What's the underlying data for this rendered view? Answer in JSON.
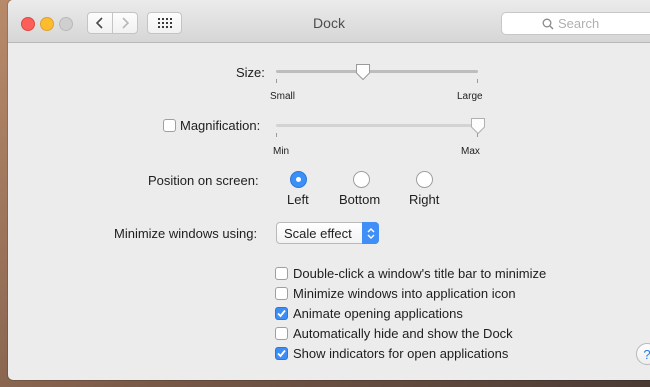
{
  "window": {
    "title": "Dock"
  },
  "search": {
    "placeholder": "Search"
  },
  "size": {
    "label": "Size:",
    "min_label": "Small",
    "max_label": "Large",
    "value_fraction": 0.43
  },
  "magnification": {
    "label": "Magnification:",
    "checked": false,
    "min_label": "Min",
    "max_label": "Max",
    "value_fraction": 1.0
  },
  "position": {
    "label": "Position on screen:",
    "options": [
      {
        "label": "Left",
        "selected": true
      },
      {
        "label": "Bottom",
        "selected": false
      },
      {
        "label": "Right",
        "selected": false
      }
    ]
  },
  "minimize": {
    "label": "Minimize windows using:",
    "selected": "Scale effect"
  },
  "checkboxes": [
    {
      "label": "Double-click a window's title bar to minimize",
      "checked": false
    },
    {
      "label": "Minimize windows into application icon",
      "checked": false
    },
    {
      "label": "Animate opening applications",
      "checked": true
    },
    {
      "label": "Automatically hide and show the Dock",
      "checked": false
    },
    {
      "label": "Show indicators for open applications",
      "checked": true
    }
  ],
  "help": {
    "label": "?"
  },
  "colors": {
    "accent": "#3c8ef6"
  }
}
